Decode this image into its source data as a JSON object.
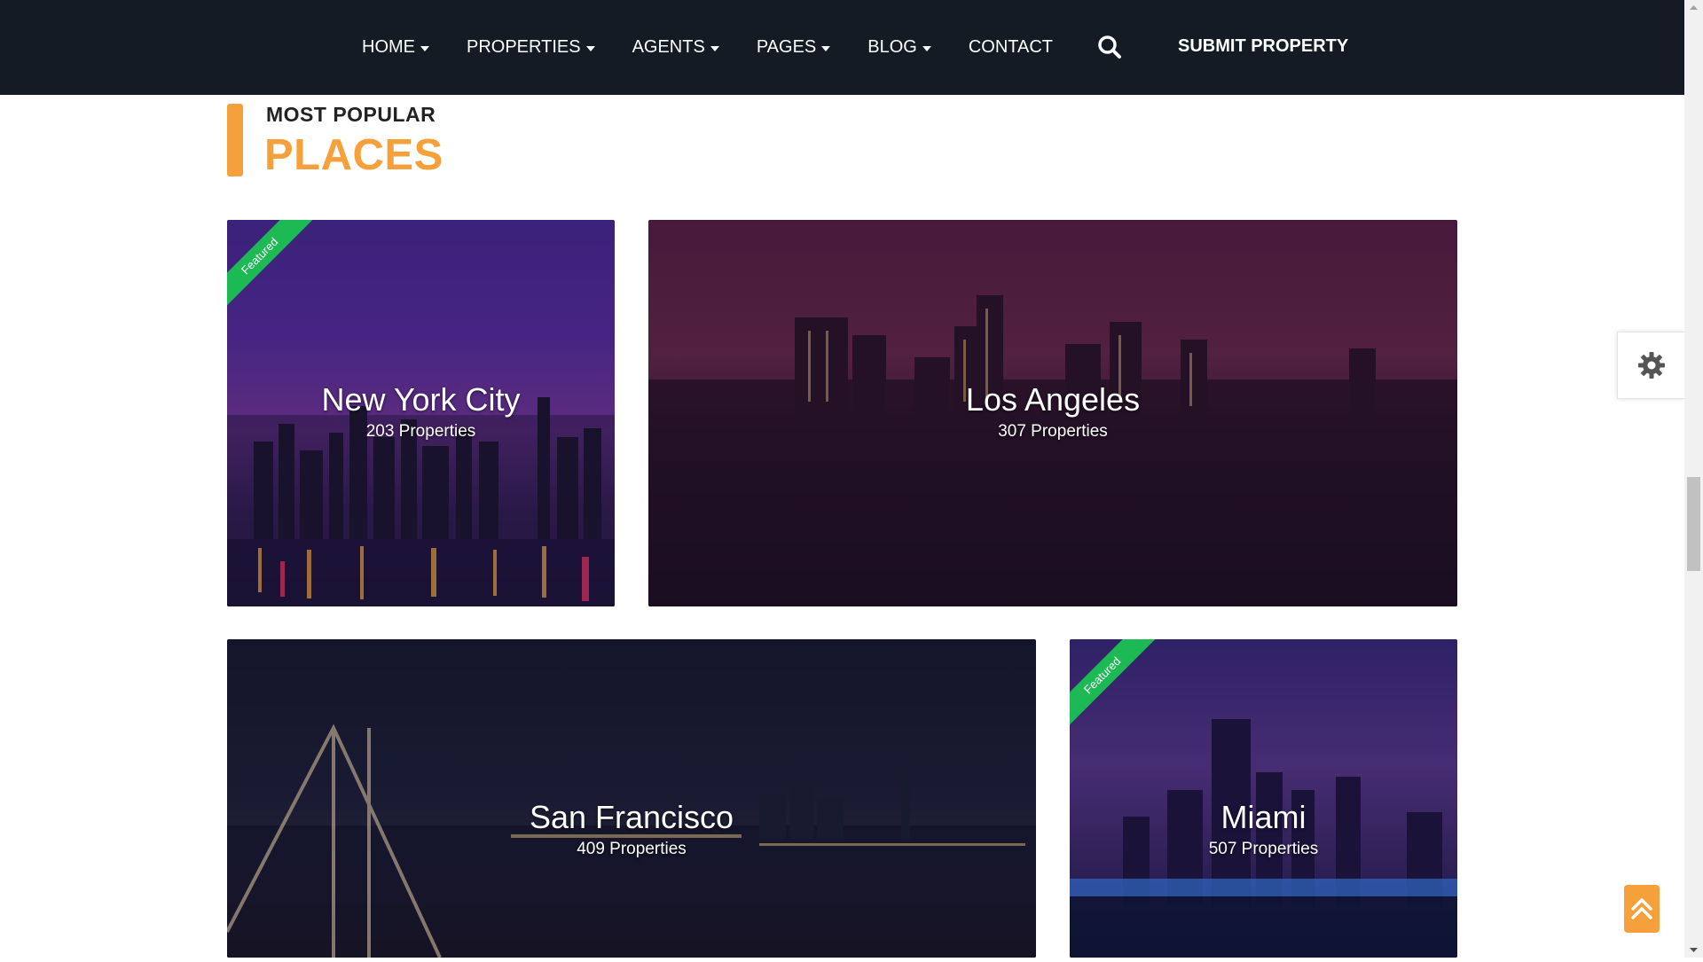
{
  "nav": {
    "items": [
      {
        "label": "HOME",
        "has_caret": true
      },
      {
        "label": "PROPERTIES",
        "has_caret": true
      },
      {
        "label": "AGENTS",
        "has_caret": true
      },
      {
        "label": "PAGES",
        "has_caret": true
      },
      {
        "label": "BLOG",
        "has_caret": true
      },
      {
        "label": "CONTACT",
        "has_caret": false
      }
    ],
    "search_icon": "search-icon",
    "submit_label": "SUBMIT PROPERTY"
  },
  "section": {
    "subtitle": "MOST POPULAR",
    "title": "PLACES"
  },
  "places": [
    {
      "name": "New York City",
      "count": "203 Properties",
      "featured": true,
      "ribbon": "Featured"
    },
    {
      "name": "Los Angeles",
      "count": "307 Properties",
      "featured": false
    },
    {
      "name": "San Francisco",
      "count": "409 Properties",
      "featured": false
    },
    {
      "name": "Miami",
      "count": "507 Properties",
      "featured": true,
      "ribbon": "Featured"
    }
  ],
  "widgets": {
    "settings_icon": "gear-icon",
    "back_to_top_icon": "double-chevron-up-icon"
  },
  "colors": {
    "nav_bg": "#141b24",
    "accent": "#f5a03b",
    "featured": "#1db954"
  }
}
